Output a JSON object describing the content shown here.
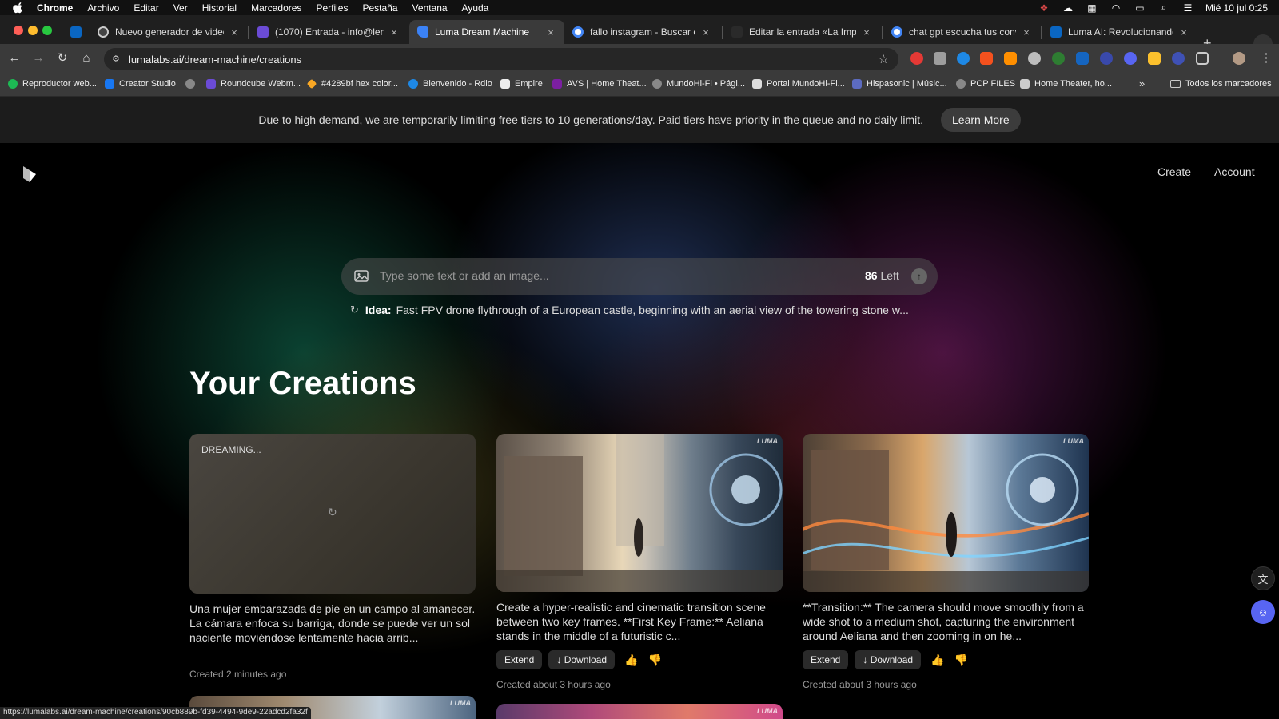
{
  "os_menubar": {
    "app": "Chrome",
    "menus": [
      "Archivo",
      "Editar",
      "Ver",
      "Historial",
      "Marcadores",
      "Perfiles",
      "Pestaña",
      "Ventana",
      "Ayuda"
    ],
    "clock": "Mié 10 jul 0:25"
  },
  "tabs": [
    {
      "title": "",
      "icon": "linkedin-icon"
    },
    {
      "title": "Nuevo generador de video",
      "icon": "openai-icon"
    },
    {
      "title": "(1070) Entrada - info@lenonfi",
      "icon": "roundcube-icon"
    },
    {
      "title": "Luma Dream Machine",
      "icon": "luma-icon",
      "active": true
    },
    {
      "title": "fallo instagram - Buscar con G",
      "icon": "google-icon"
    },
    {
      "title": "Editar la entrada «La Importar",
      "icon": "wordpress-icon"
    },
    {
      "title": "chat gpt escucha tus convers",
      "icon": "google-icon"
    },
    {
      "title": "Luma AI: Revolucionando la C",
      "icon": "linkedin-icon"
    }
  ],
  "address_bar": {
    "url": "lumalabs.ai/dream-machine/creations"
  },
  "bookmarks": [
    "Reproductor web...",
    "Creator Studio",
    "",
    "Roundcube Webm...",
    "#4289bf hex color...",
    "Bienvenido - Rdio",
    "Empire",
    "AVS | Home Theat...",
    "MundoHi-Fi • Pági...",
    "Portal MundoHi-Fi...",
    "Hispasonic | Músic...",
    "PCP FILES",
    "Home Theater, ho..."
  ],
  "bookmarks_all": "Todos los marcadores",
  "banner": {
    "message": "Due to high demand, we are temporarily limiting free tiers to 10 generations/day. Paid tiers have priority in the queue and no daily limit.",
    "button": "Learn More"
  },
  "nav": {
    "create": "Create",
    "account": "Account"
  },
  "prompt": {
    "placeholder": "Type some text or add an image...",
    "remaining_count": "86",
    "remaining_label": "Left"
  },
  "idea": {
    "label": "Idea:",
    "text": "Fast FPV drone flythrough of a European castle, beginning with an aerial view of the towering stone w..."
  },
  "section_title": "Your Creations",
  "creations": [
    {
      "status": "DREAMING...",
      "description": "Una mujer embarazada de pie en un campo al amanecer. La cámara enfoca su barriga, donde se puede ver un sol naciente moviéndose lentamente hacia arrib...",
      "created": "Created 2 minutes ago"
    },
    {
      "description": "Create a hyper-realistic and cinematic transition scene between two key frames. **First Key Frame:** Aeliana stands in the middle of a futuristic c...",
      "extend": "Extend",
      "download": "Download",
      "created": "Created about 3 hours ago",
      "watermark": "LUMA"
    },
    {
      "description": "**Transition:** The camera should move smoothly from a wide shot to a medium shot, capturing the environment around Aeliana and then zooming in on he...",
      "extend": "Extend",
      "download": "Download",
      "created": "Created about 3 hours ago",
      "watermark": "LUMA"
    }
  ],
  "status_url": "https://lumalabs.ai/dream-machine/creations/90cb889b-fd39-4494-9de9-22adcd2fa32f"
}
